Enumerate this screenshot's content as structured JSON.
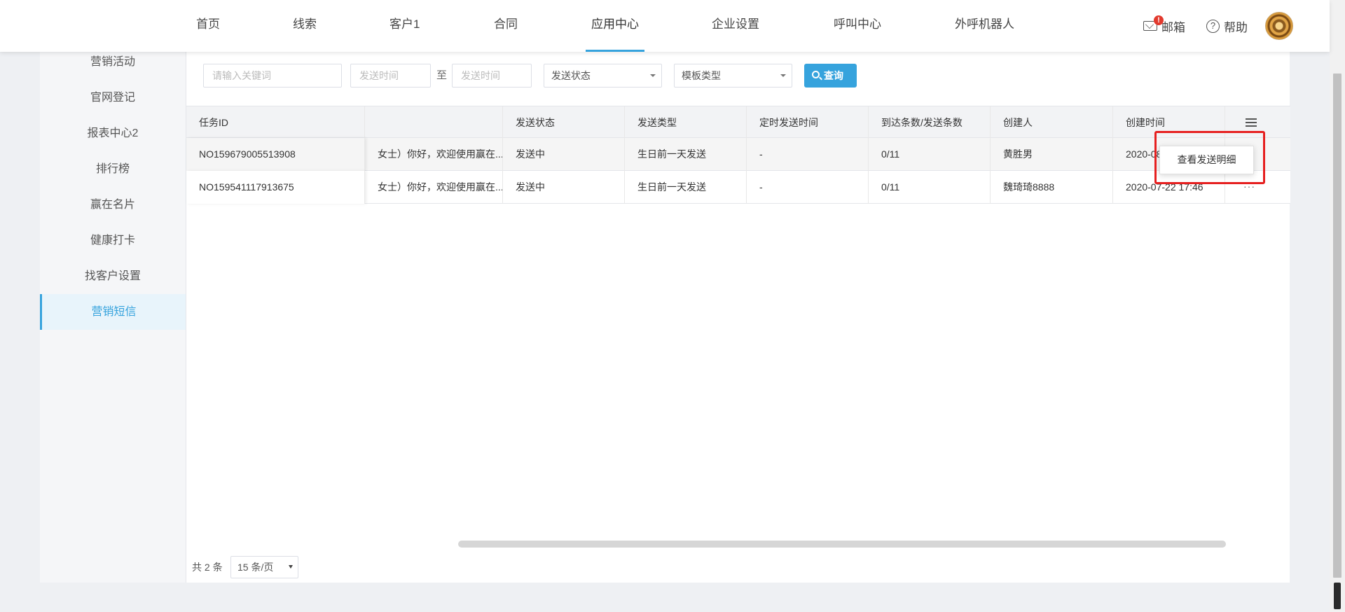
{
  "nav": {
    "items": [
      "首页",
      "线索",
      "客户1",
      "合同",
      "应用中心",
      "企业设置",
      "呼叫中心",
      "外呼机器人"
    ],
    "active_index": 4,
    "mail_label": "邮箱",
    "mail_badge": "!",
    "help_label": "帮助",
    "help_glyph": "?"
  },
  "sidebar": {
    "items": [
      "营销活动",
      "官网登记",
      "报表中心2",
      "排行榜",
      "赢在名片",
      "健康打卡",
      "找客户设置",
      "营销短信"
    ],
    "active_index": 7
  },
  "filters": {
    "keyword_placeholder": "请输入关键词",
    "start_time_placeholder": "发送时间",
    "to_label": "至",
    "end_time_placeholder": "发送时间",
    "status_select": "发送状态",
    "template_select": "模板类型",
    "query_label": "查询"
  },
  "table": {
    "headers": [
      "任务ID",
      "",
      "发送状态",
      "发送类型",
      "定时发送时间",
      "到达条数/发送条数",
      "创建人",
      "创建时间"
    ],
    "rows": [
      {
        "id": "NO159679005513908",
        "content": "女士）你好，欢迎使用赢在...",
        "status": "发送中",
        "type": "生日前一天发送",
        "scheduled": "-",
        "count": "0/11",
        "creator": "黄胜男",
        "created": "2020-08"
      },
      {
        "id": "NO159541117913675",
        "content": "女士）你好，欢迎使用赢在...",
        "status": "发送中",
        "type": "生日前一天发送",
        "scheduled": "-",
        "count": "0/11",
        "creator": "魏琦琦8888",
        "created": "2020-07-22 17:46"
      }
    ],
    "more_glyph": "···"
  },
  "popover": {
    "label": "查看发送明细"
  },
  "pagination": {
    "total_label": "共 2 条",
    "page_size": "15 条/页"
  },
  "colors": {
    "accent": "#36a3dd",
    "highlight_box": "#e62020",
    "badge": "#e23a2e"
  },
  "icons": [
    "mail-icon",
    "help-icon",
    "search-icon",
    "list-settings-icon",
    "more-icon",
    "avatar"
  ]
}
